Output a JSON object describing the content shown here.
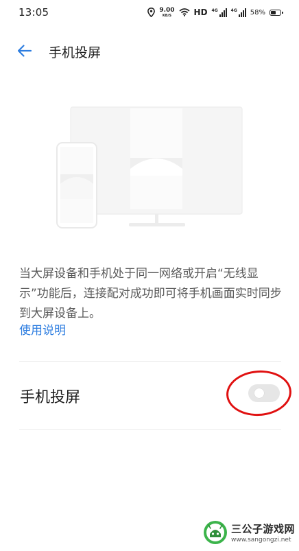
{
  "status_bar": {
    "time": "13:05",
    "net_speed_value": "9.00",
    "net_speed_unit": "KB/S",
    "hd_label": "HD",
    "signal_1_label": "4G",
    "signal_2_label": "4G",
    "battery_percent": "58%",
    "battery_level": 0.58,
    "icons": [
      "location-icon",
      "wifi-icon",
      "signal-icon",
      "battery-icon"
    ]
  },
  "header": {
    "title": "手机投屏",
    "back_icon": "arrow-left-icon"
  },
  "description": {
    "text": "当大屏设备和手机处于同一网络或开启“无线显示”功能后，连接配对成功即可将手机画面实时同步到大屏设备上。",
    "link": "使用说明"
  },
  "setting": {
    "label": "手机投屏",
    "enabled": false
  },
  "watermark": {
    "title": "三公子游戏网",
    "url": "www.sangongzi.net"
  },
  "colors": {
    "accent": "#2d7de0",
    "highlight": "#e01010",
    "toggle_off": "#e6e6e6"
  }
}
